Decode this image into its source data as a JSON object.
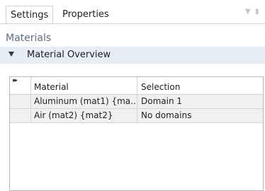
{
  "tabs": [
    {
      "label": "Settings",
      "active": true
    },
    {
      "label": "Properties",
      "active": false
    }
  ],
  "window_controls": {
    "pin_icon": "pin-icon",
    "dock_icon": "dock-icon"
  },
  "section": {
    "title": "Materials"
  },
  "material_overview": {
    "label": "Material Overview",
    "expanded": true
  },
  "table": {
    "columns": [
      "Material",
      "Selection"
    ],
    "rows": [
      {
        "material": "Aluminum (mat1) {ma...",
        "selection": "Domain 1"
      },
      {
        "material": "Air (mat2) {mat2}",
        "selection": "No domains"
      }
    ]
  },
  "colors": {
    "section_title": "#5a6f86",
    "collapse_bar_bg": "#e6edf4",
    "row_bg": "#f0f0f0",
    "border": "#b8b8b8"
  }
}
